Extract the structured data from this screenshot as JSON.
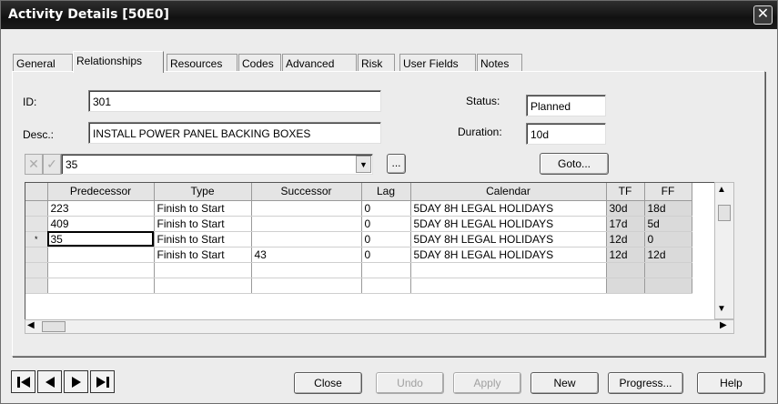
{
  "window": {
    "title": "Activity Details [50E0]"
  },
  "tabs": [
    {
      "label": "General"
    },
    {
      "label": "Relationships",
      "active": true
    },
    {
      "label": "Resources"
    },
    {
      "label": "Codes"
    },
    {
      "label": "Advanced"
    },
    {
      "label": "Risk"
    },
    {
      "label": "User Fields"
    },
    {
      "label": "Notes"
    }
  ],
  "form": {
    "id_label": "ID:",
    "id_value": "301",
    "desc_label": "Desc.:",
    "desc_value": "INSTALL POWER PANEL BACKING BOXES",
    "status_label": "Status:",
    "status_value": "Planned",
    "duration_label": "Duration:",
    "duration_value": "10d",
    "edit_value": "35",
    "ellipsis_label": "...",
    "goto_label": "Goto..."
  },
  "grid": {
    "columns": [
      "Predecessor",
      "Type",
      "Successor",
      "Lag",
      "Calendar",
      "TF",
      "FF"
    ],
    "rows": [
      {
        "marker": "",
        "pred": "223",
        "type": "Finish to Start",
        "succ": "",
        "lag": "0",
        "cal": "5DAY 8H LEGAL HOLIDAYS",
        "tf": "30d",
        "ff": "18d"
      },
      {
        "marker": "",
        "pred": "409",
        "type": "Finish to Start",
        "succ": "",
        "lag": "0",
        "cal": "5DAY 8H LEGAL HOLIDAYS",
        "tf": "17d",
        "ff": "5d"
      },
      {
        "marker": "*",
        "pred": "35",
        "type": "Finish to Start",
        "succ": "",
        "lag": "0",
        "cal": "5DAY 8H LEGAL HOLIDAYS",
        "tf": "12d",
        "ff": "0"
      },
      {
        "marker": "",
        "pred": "",
        "type": "Finish to Start",
        "succ": "43",
        "lag": "0",
        "cal": "5DAY 8H LEGAL HOLIDAYS",
        "tf": "12d",
        "ff": "12d"
      },
      {
        "marker": "",
        "pred": "",
        "type": "",
        "succ": "",
        "lag": "",
        "cal": "",
        "tf": "",
        "ff": ""
      },
      {
        "marker": "",
        "pred": "",
        "type": "",
        "succ": "",
        "lag": "",
        "cal": "",
        "tf": "",
        "ff": ""
      }
    ]
  },
  "buttons": {
    "close": "Close",
    "undo": "Undo",
    "apply": "Apply",
    "new": "New",
    "progress": "Progress...",
    "help": "Help"
  },
  "icons": {
    "nav": [
      "first-record-icon",
      "previous-record-icon",
      "next-record-icon",
      "last-record-icon"
    ]
  }
}
